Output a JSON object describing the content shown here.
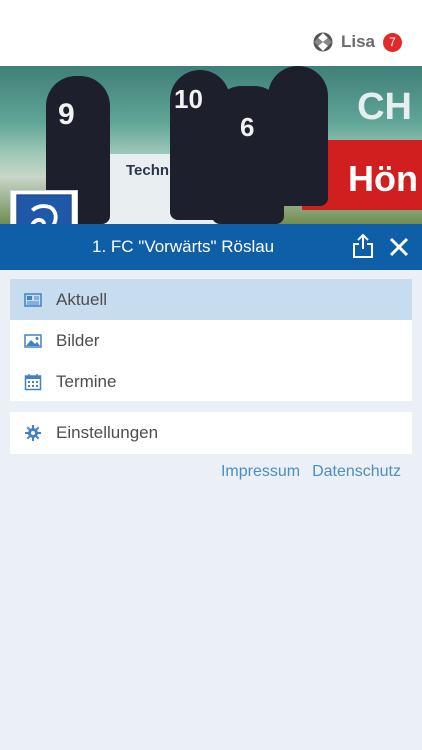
{
  "user": {
    "name": "Lisa",
    "badge_count": "7"
  },
  "hero": {
    "banner_brand": "Hön",
    "banner_sponsor": "Technisc",
    "banner_top": "CH",
    "jersey_numbers": [
      "9",
      "10",
      "6"
    ]
  },
  "club": {
    "title": "1. FC \"Vorwärts\" Röslau",
    "crest_text": "FC Vorwärts Röslau"
  },
  "menu": {
    "items": [
      {
        "label": "Aktuell",
        "icon": "newspaper-icon",
        "active": true
      },
      {
        "label": "Bilder",
        "icon": "image-icon",
        "active": false
      },
      {
        "label": "Termine",
        "icon": "calendar-icon",
        "active": false
      }
    ],
    "settings": {
      "label": "Einstellungen",
      "icon": "gear-icon"
    }
  },
  "footer": {
    "impressum": "Impressum",
    "datenschutz": "Datenschutz"
  },
  "colors": {
    "brand_blue": "#0e5ea8",
    "active_row": "#c8dcef",
    "link": "#4d8cc4",
    "badge": "#e02a2a",
    "icon_blue": "#3f82c6"
  }
}
